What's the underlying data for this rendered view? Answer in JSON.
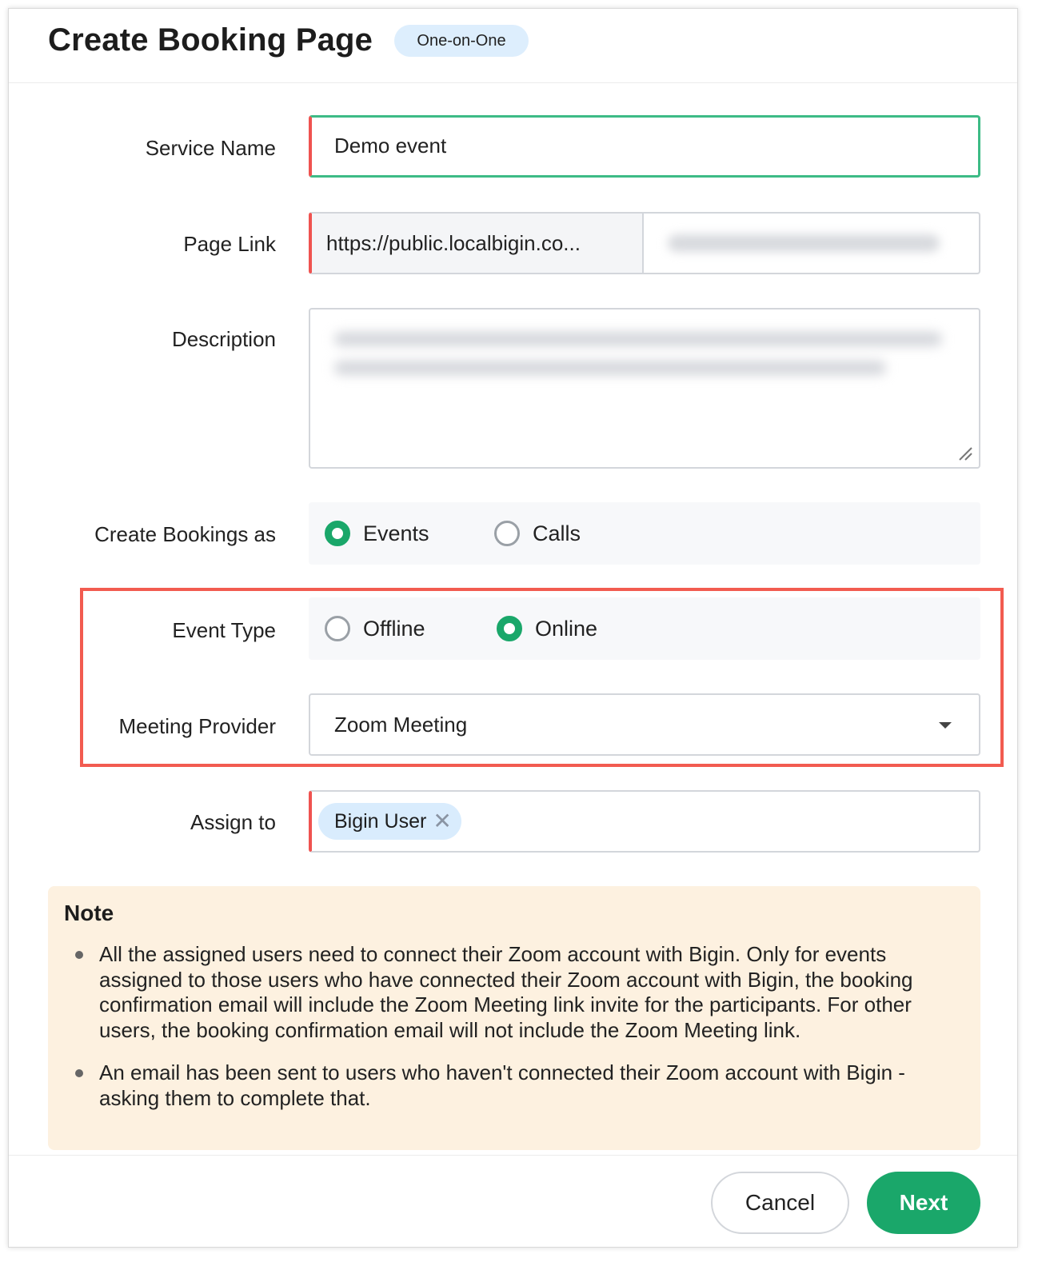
{
  "header": {
    "title": "Create Booking Page",
    "badge": "One-on-One"
  },
  "form": {
    "service_name": {
      "label": "Service Name",
      "value": "Demo event"
    },
    "page_link": {
      "label": "Page Link",
      "prefix": "https://public.localbigin.co..."
    },
    "description": {
      "label": "Description"
    },
    "create_bookings_as": {
      "label": "Create Bookings as",
      "options": [
        "Events",
        "Calls"
      ],
      "selected": "Events"
    },
    "event_type": {
      "label": "Event Type",
      "options": [
        "Offline",
        "Online"
      ],
      "selected": "Online"
    },
    "meeting_provider": {
      "label": "Meeting Provider",
      "value": "Zoom Meeting"
    },
    "assign_to": {
      "label": "Assign to",
      "chips": [
        "Bigin User"
      ]
    }
  },
  "note": {
    "title": "Note",
    "items": [
      "All the assigned users need to connect their Zoom account with Bigin. Only for events assigned to those users who have connected their Zoom account with Bigin, the booking confirmation email will include the Zoom Meeting link invite for the participants. For other users, the booking confirmation email will not include the Zoom Meeting link.",
      "An email has been sent to users who haven't connected their Zoom account with Bigin - asking them to complete that."
    ]
  },
  "footer": {
    "cancel_label": "Cancel",
    "next_label": "Next"
  },
  "colors": {
    "accent": "#1aa76a",
    "required": "#ef5350",
    "highlight": "#f25b50",
    "badge_bg": "#ddeefd",
    "note_bg": "#fdf1e0"
  }
}
